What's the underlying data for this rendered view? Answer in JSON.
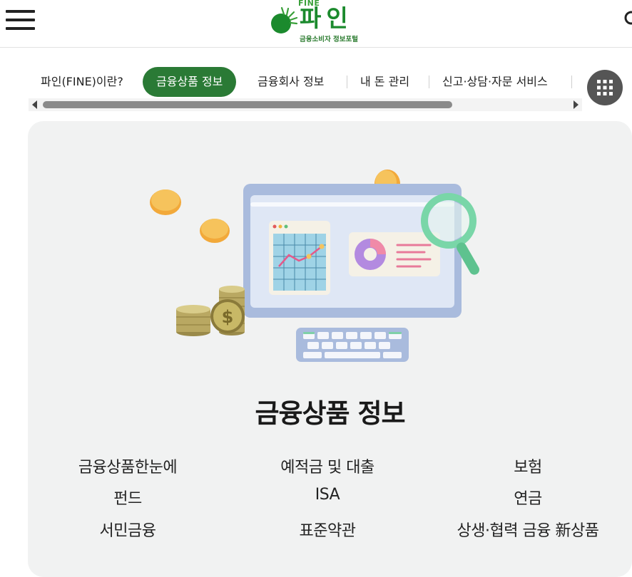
{
  "header": {
    "menu_icon": "hamburger-menu-icon",
    "logo": {
      "badge_text": "FINE",
      "main_text": "파인",
      "sub_text": "금융소비자 정보포털"
    },
    "search_icon": "search-icon"
  },
  "nav": {
    "items": [
      {
        "label": "파인(FINE)이란?",
        "active": false
      },
      {
        "label": "금융상품 정보",
        "active": true
      },
      {
        "label": "금융회사 정보",
        "active": false
      },
      {
        "label": "내 돈 관리",
        "active": false
      },
      {
        "label": "신고·상담·자문 서비스",
        "active": false
      }
    ],
    "all_menu_icon": "grid-icon",
    "scroll_progress": 0.77
  },
  "card": {
    "title": "금융상품 정보",
    "links": [
      [
        "금융상품한눈에",
        "예적금 및 대출",
        "보험"
      ],
      [
        "펀드",
        "ISA",
        "연금"
      ],
      [
        "서민금융",
        "표준약관",
        "상생·협력 금융 新상품"
      ]
    ]
  },
  "colors": {
    "brand_green": "#2a7a35",
    "card_bg": "#f1f2f2",
    "scroll_thumb": "#8a8a8a"
  }
}
